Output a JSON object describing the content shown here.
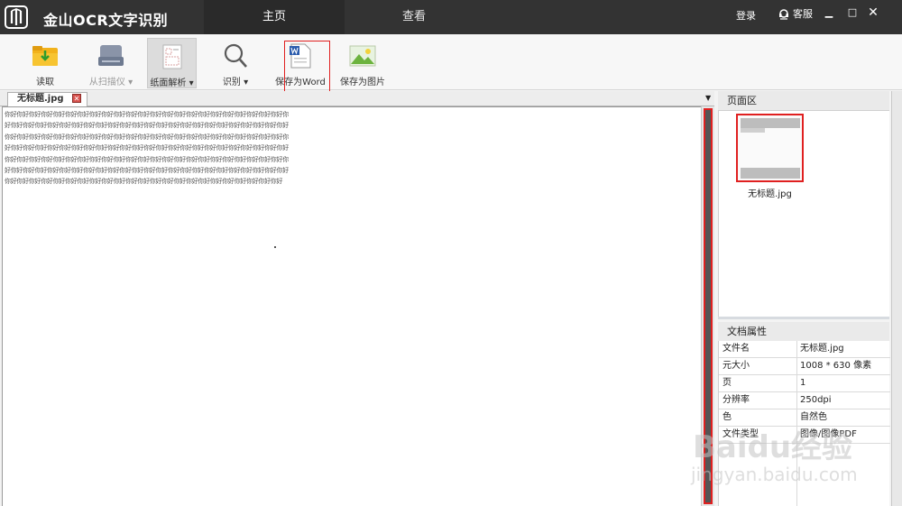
{
  "header": {
    "app_title": "金山OCR文字识别",
    "tabs": [
      {
        "label": "主页",
        "active": true
      },
      {
        "label": "查看",
        "active": false
      }
    ],
    "login_label": "登录",
    "service_label": "客服",
    "window_controls": {
      "minimize": "▁",
      "maximize": "□",
      "close": "✕"
    }
  },
  "toolbar": {
    "items": [
      {
        "label": "读取",
        "icon": "folder-open-icon",
        "disabled": false
      },
      {
        "label": "从扫描仪 ▾",
        "icon": "scanner-icon",
        "disabled": true
      },
      {
        "label": "纸面解析 ▾",
        "icon": "layout-analysis-icon",
        "disabled": false,
        "pressed": true
      },
      {
        "label": "识别 ▾",
        "icon": "magnifier-icon",
        "disabled": false
      },
      {
        "label": "保存为Word",
        "icon": "word-document-icon",
        "disabled": false,
        "highlighted": true
      },
      {
        "label": "保存为图片",
        "icon": "image-icon",
        "disabled": false
      }
    ]
  },
  "document": {
    "tab_label": "无标题.jpg",
    "tab_close": "✕",
    "dropdown": "▼",
    "ocr_text": "你好你好你好你好你好你好你好你好你好你好你好你好你好你好你好你好你好你好你好你好你好你好你好你好你好你好你好你好你好你好你好你好你好你好你好你好你好你好你好你好你好你好你好你好你好你好你好你好你好你好你好你好你好你好你好你好你好你好你好你好你好你好你好你好你好你好你好你好你好你好你好你好你好你好你好你好你好你好你好你好你好你好你好你好你好你好你好你好你好你好你好你好你好你好你好你好你好你好你好你好你好你好你好你好你好你好你好你好你好你好你好你好你好你好你好你好你好你好你好你好你好你好你好你好你好你好你好你好你好你好你好你好你好你好你好你好你好你好你好你好你好你好你好你好你好你好你好你好你好你好你好你好你好你好你好你好你好你好你好你好你好你好你好你好"
  },
  "page_panel": {
    "header": "页面区",
    "thumbnail_label": "无标题.jpg"
  },
  "properties": {
    "header": "文档属性",
    "rows": [
      {
        "key": "文件名",
        "value": "无标题.jpg"
      },
      {
        "key": "元大小",
        "value": "1008 * 630 像素"
      },
      {
        "key": "页",
        "value": "1"
      },
      {
        "key": "分辨率",
        "value": "250dpi"
      },
      {
        "key": "色",
        "value": "自然色"
      },
      {
        "key": "文件类型",
        "value": "图像/图像PDF"
      }
    ]
  },
  "watermark": {
    "line1": "Baidu经验",
    "line2": "jingyan.baidu.com"
  },
  "colors": {
    "titlebar": "#333333",
    "highlight": "#e02020",
    "toolbar": "#f7f7f7"
  }
}
